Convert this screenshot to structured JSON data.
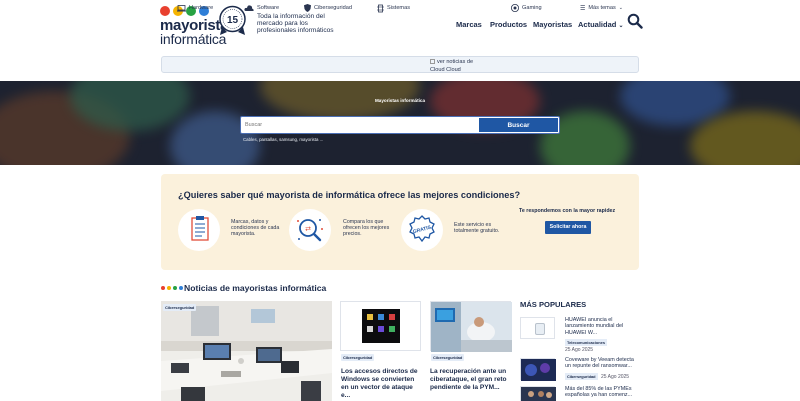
{
  "brand": {
    "logo_line1": "mayoristas",
    "logo_line2": "informática",
    "anniversary_badge": "15",
    "tagline": "Toda la información del mercado para los profesionales informáticos",
    "dot_colors": [
      "#e8402f",
      "#f5b400",
      "#27a243",
      "#2f7fd8"
    ]
  },
  "nav": {
    "items": [
      "Marcas",
      "Productos",
      "Mayoristas",
      "Actualidad"
    ],
    "search_icon": "search-icon"
  },
  "categories": {
    "items": [
      "Hardware",
      "Software",
      "Ciberseguridad",
      "Sistemas",
      "ver noticias de Cloud Cloud",
      "Gaming",
      "Más temas"
    ]
  },
  "hero": {
    "title": "Mayoristas informática",
    "search_placeholder": "Buscar",
    "search_button": "Buscar",
    "hint": "Cables, pantallas, samsung, mayorista ..."
  },
  "cta": {
    "title": "¿Quieres saber qué mayorista de informática ofrece las mejores condiciones?",
    "features": [
      {
        "text": "Marcas, datos y condiciones de cada mayorista.",
        "icon": "clipboard-icon"
      },
      {
        "text": "Compara los que ofrecen los mejores precios.",
        "icon": "magnifier-compare-icon"
      },
      {
        "text": "Este servicio es totalmente gratuito.",
        "icon": "gratis-badge-icon"
      }
    ],
    "side_text": "Te respondemos con la mayor rapidez",
    "button": "Solicitar ahora"
  },
  "news": {
    "title": "Noticias de mayoristas informática",
    "big_card": {
      "tag": "Ciberseguridad"
    },
    "cards": [
      {
        "tag": "Ciberseguridad",
        "headline": "Los accesos directos de Windows se convierten en un vector de ataque e..."
      },
      {
        "tag": "Ciberseguridad",
        "headline": "La recuperación ante un ciberataque, el gran reto pendiente de la PYM..."
      }
    ]
  },
  "popular": {
    "title": "MÁS POPULARES",
    "items": [
      {
        "rank": "1",
        "headline": "HUAWEI anuncia el lanzamiento mundial del HUAWEI W...",
        "tag": "Telecomunicaciones",
        "date": "25 Ago 2025"
      },
      {
        "rank": "2",
        "headline": "Coveware by Veeam detecta un repunte del ransomwar...",
        "tag": "Ciberseguridad",
        "date": "25 Ago 2025"
      },
      {
        "rank": "3",
        "headline": "Más del 85% de las PYMEs españolas ya han comenz..."
      }
    ]
  }
}
